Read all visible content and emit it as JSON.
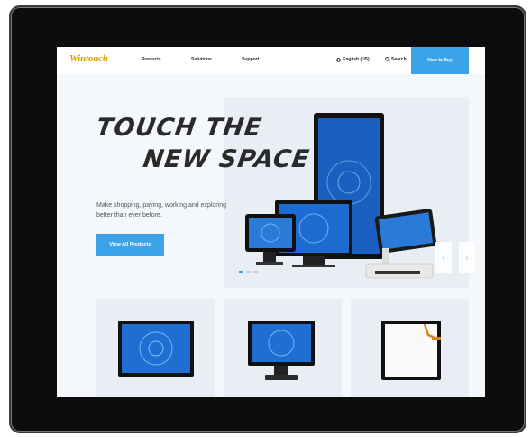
{
  "header": {
    "logo": "Wintouch",
    "nav": [
      {
        "label": "Products"
      },
      {
        "label": "Solutions"
      },
      {
        "label": "Support"
      }
    ],
    "language": "English (US)",
    "search": "Search",
    "buy_button": "How to Buy"
  },
  "hero": {
    "title_line1": "TOUCH THE",
    "title_line2": "NEW SPACE",
    "subtitle": "Make shopping, paying, working and exploring better than ever before.",
    "cta": "View All Products",
    "slides": 3,
    "active_slide": 1
  },
  "icons": {
    "globe": "globe-icon",
    "search": "search-icon",
    "prev": "chevron-left-icon",
    "next": "chevron-right-icon"
  },
  "colors": {
    "accent": "#3da3e8",
    "logo": "#d7a300",
    "bezel": "#0d0d0d"
  }
}
